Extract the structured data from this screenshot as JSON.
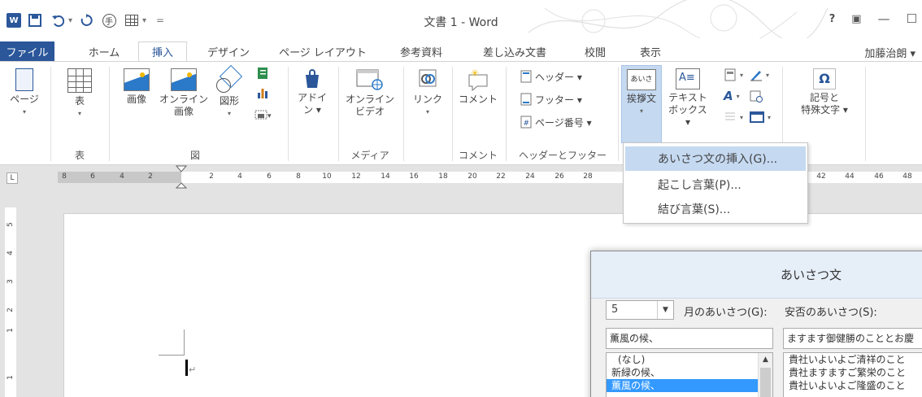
{
  "title_bar": {
    "title": "文書 1 - Word",
    "help": "?",
    "ribbon_display": "▣",
    "minimize": "—",
    "restore": "☐"
  },
  "qat": {
    "app_icon": "W",
    "undo_dropdown": "▾",
    "touch_mode": "手",
    "table_dropdown": "▾",
    "customize": "="
  },
  "tabs": {
    "file": "ファイル",
    "home": "ホーム",
    "insert": "挿入",
    "design": "デザイン",
    "page_layout": "ページ レイアウト",
    "references": "参考資料",
    "mailings": "差し込み文書",
    "review": "校閲",
    "view": "表示",
    "user": "加藤治朗 ▾"
  },
  "ribbon": {
    "pages": "ページ",
    "table": "表",
    "picture": "画像",
    "online_picture_1": "オンライン",
    "online_picture_2": "画像",
    "shapes": "図形",
    "addin_1": "アドイ",
    "addin_2": "ン ▾",
    "online_video_1": "オンライン",
    "online_video_2": "ビデオ",
    "link": "リンク",
    "comment": "コメント",
    "header": "ヘッダー ▾",
    "footer": "フッター ▾",
    "page_number": "ページ番号 ▾",
    "greeting": "挨拶文",
    "textbox_1": "テキスト",
    "textbox_2": "ボックス ▾",
    "symbol_1": "記号と",
    "symbol_2": "特殊文字 ▾",
    "groups": {
      "table": "表",
      "illustrations": "図",
      "media": "メディア",
      "comments": "コメント",
      "header_footer": "ヘッダーとフッター"
    }
  },
  "greeting_menu": {
    "items": [
      "あいさつ文の挿入(G)...",
      "起こし言葉(P)...",
      "結び言葉(S)..."
    ]
  },
  "ruler": {
    "tab_selector": "L",
    "ticks": [
      "8",
      "6",
      "4",
      "2",
      "2",
      "4",
      "6",
      "8",
      "10",
      "12",
      "14",
      "16",
      "18",
      "20",
      "22",
      "24",
      "26",
      "28",
      "42",
      "44",
      "46",
      "48"
    ],
    "vertical_ticks": [
      "5",
      "4",
      "3",
      "2",
      "1",
      "1"
    ]
  },
  "dialog": {
    "title": "あいさつ文",
    "month_value": "5",
    "month_label": "月のあいさつ(G):",
    "health_label": "安否のあいさつ(S):",
    "month_greeting_value": "薫風の候、",
    "health_greeting_value": "ますます御健勝のこととお慶",
    "month_list": [
      "(なし)",
      "新緑の候、",
      "薫風の候、"
    ],
    "health_list": [
      "貴社いよいよご清祥のこと",
      "貴社ますますご繁栄のこと",
      "貴社いよいよご隆盛のこと"
    ]
  },
  "document": {
    "para_mark": "↵"
  },
  "colors": {
    "accent": "#2b579a",
    "menu_hover": "#c5d9f1",
    "list_selected": "#3399ff"
  }
}
